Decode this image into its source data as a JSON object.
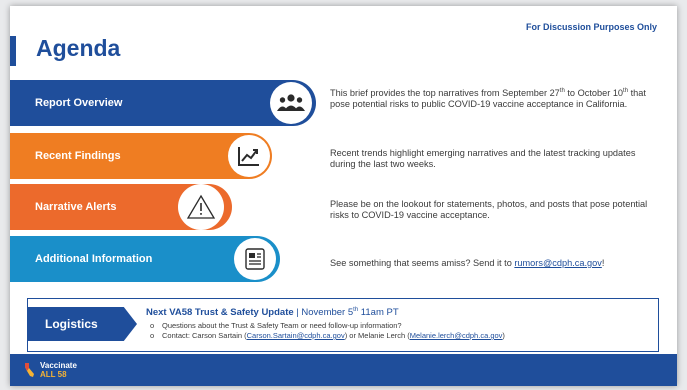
{
  "header": {
    "discussion_note": "For Discussion Purposes Only",
    "title": "Agenda"
  },
  "agenda": [
    {
      "label": "Report Overview",
      "color": "#1f4e9b",
      "icon": "people-group-icon",
      "text_a": "This brief provides the top narratives from September 27",
      "sup_a": "th",
      "text_b": " to October 10",
      "sup_b": "th",
      "text_c": " that pose potential risks to public COVID-19 vaccine acceptance in California."
    },
    {
      "label": "Recent Findings",
      "color": "#ef7d22",
      "icon": "trend-chart-icon",
      "text": "Recent trends highlight emerging narratives and the latest tracking updates during the last two weeks."
    },
    {
      "label": "Narrative Alerts",
      "color": "#ec6a2c",
      "icon": "warning-triangle-icon",
      "text": "Please be on the lookout for statements, photos, and posts that pose potential risks to COVID-19 vaccine acceptance."
    },
    {
      "label": "Additional Information",
      "color": "#1a8fc9",
      "icon": "document-icon",
      "text_pre": "See something that seems amiss? Send it to ",
      "link": "rumors@cdph.ca.gov",
      "text_post": "!"
    }
  ],
  "logistics": {
    "label": "Logistics",
    "next_update_bold": "Next VA58 Trust & Safety Update",
    "next_update_rest": " | November 5",
    "next_update_sup": "th",
    "next_update_time": " 11am PT",
    "bullets": [
      {
        "text": "Questions about the Trust & Safety Team or need follow-up information?"
      },
      {
        "pre": "Contact: Carson Sartain (",
        "link1": "Carson.Sartain@cdph.ca.gov",
        "mid": ") or Melanie Lerch (",
        "link2": "Melanie.lerch@cdph.ca.gov",
        "post": ")"
      }
    ],
    "bullet_glyph": "o"
  },
  "footer": {
    "logo_line1": "Vaccinate",
    "logo_line2": "ALL 58"
  }
}
